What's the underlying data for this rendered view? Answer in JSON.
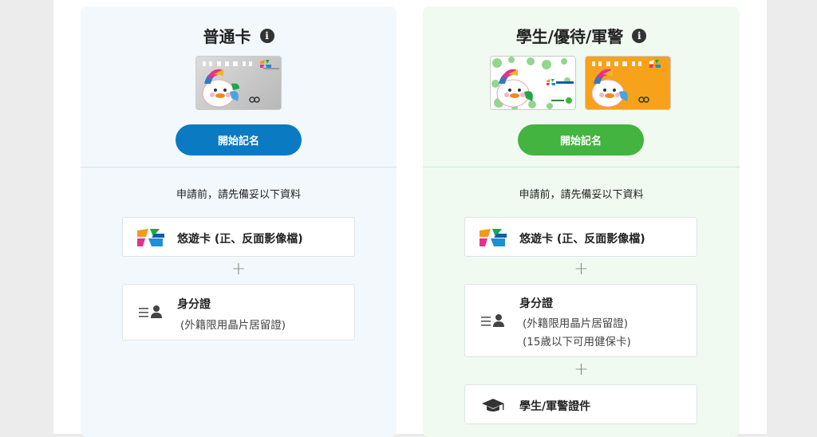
{
  "general": {
    "title": "普通卡",
    "cta_label": "開始記名",
    "prep_text": "申請前，請先備妥以下資料",
    "requirements": [
      {
        "icon": "easycard-logo-icon",
        "title": "悠遊卡 (正、反面影像檔)"
      },
      {
        "icon": "id-card-icon",
        "title": "身分證",
        "subs": [
          "(外籍限用晶片居留證)"
        ]
      }
    ]
  },
  "student": {
    "title": "學生/優待/軍警",
    "cta_label": "開始記名",
    "prep_text": "申請前，請先備妥以下資料",
    "requirements": [
      {
        "icon": "easycard-logo-icon",
        "title": "悠遊卡 (正、反面影像檔)"
      },
      {
        "icon": "id-card-icon",
        "title": "身分證",
        "subs": [
          "(外籍限用晶片居留證)",
          "(15歲以下可用健保卡)"
        ]
      },
      {
        "icon": "graduation-cap-icon",
        "title": "學生/軍警證件"
      }
    ]
  },
  "plus_sign": "+",
  "info_glyph": "i",
  "colors": {
    "general_accent": "#0a7ac3",
    "student_accent": "#43b440"
  }
}
